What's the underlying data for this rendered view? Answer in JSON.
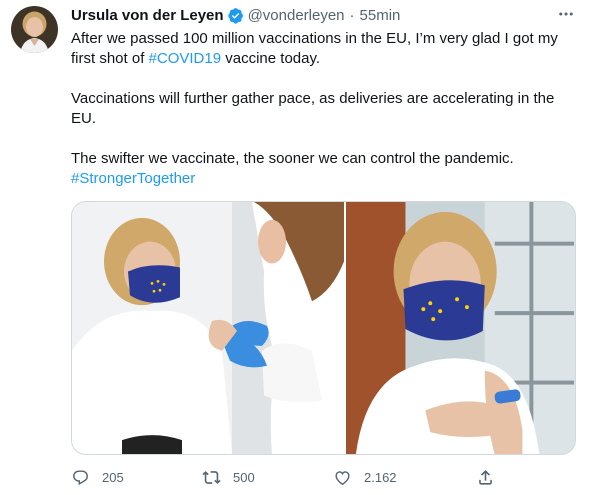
{
  "tweet": {
    "author": {
      "display_name": "Ursula von der Leyen",
      "handle": "@vonderleyen",
      "verified": true,
      "avatar_icon": "profile-photo"
    },
    "separator": "·",
    "timestamp": "55min",
    "more_icon": "more-dots-icon",
    "paragraphs": [
      {
        "text_before": "After we passed 100 million vaccinations in the EU, I’m very glad I got my first shot of ",
        "hashtag": "#COVID19",
        "text_after": " vaccine today."
      },
      {
        "text": "Vaccinations will further gather pace, as deliveries are accelerating in the EU."
      },
      {
        "text": "The swifter we vaccinate, the sooner we can control the pandemic.",
        "hashtag": "#StrongerTogether"
      }
    ],
    "media": [
      {
        "description": "vaccination-photo"
      },
      {
        "description": "bandage-arm-photo"
      }
    ],
    "actions": {
      "reply": {
        "icon": "reply-icon",
        "count": "205"
      },
      "retweet": {
        "icon": "retweet-icon",
        "count": "500"
      },
      "like": {
        "icon": "heart-icon",
        "count": "2.162"
      },
      "share": {
        "icon": "share-icon"
      }
    },
    "colors": {
      "link": "#1d9bf0",
      "secondary_text": "#536471",
      "verified": "#1d9bf0",
      "border": "#cfd9de"
    }
  }
}
